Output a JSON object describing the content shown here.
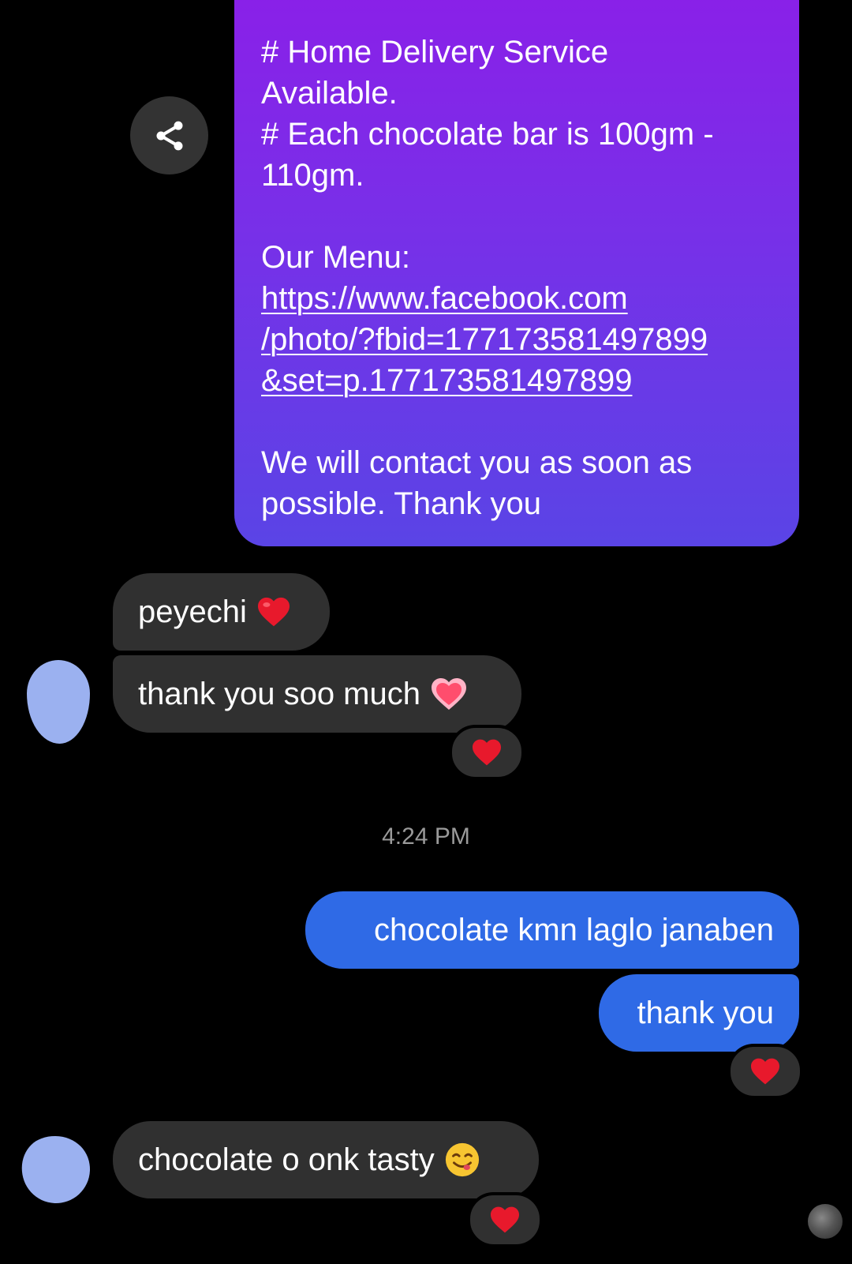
{
  "big_message": {
    "lines_top": [
      "# Home Delivery Service",
      "Available.",
      "# Each chocolate bar is 100gm -",
      "110gm."
    ],
    "menu_label": "Our Menu:",
    "link_lines": [
      "https://www.facebook.com",
      "/photo/?fbid=177173581497899",
      "&set=p.177173581497899"
    ],
    "closing_lines": [
      "We will contact you as soon as",
      "possible. Thank you"
    ]
  },
  "share_button": {
    "icon": "share-icon"
  },
  "messages": {
    "incoming_1": "peyechi",
    "incoming_2": "thank you soo much",
    "timestamp": "4:24 PM",
    "outgoing_1": "chocolate kmn laglo janaben",
    "outgoing_2": "thank you",
    "incoming_3": "chocolate o onk tasty"
  },
  "colors": {
    "background": "#000000",
    "incoming_bubble": "#303030",
    "outgoing_bubble": "#2f6ae6",
    "gradient_top": "#8b1fe8",
    "gradient_bottom": "#5a44e6",
    "heart": "#e8192c"
  },
  "reactions": {
    "incoming_2": "red-heart",
    "outgoing_2": "red-heart",
    "incoming_3": "red-heart"
  }
}
